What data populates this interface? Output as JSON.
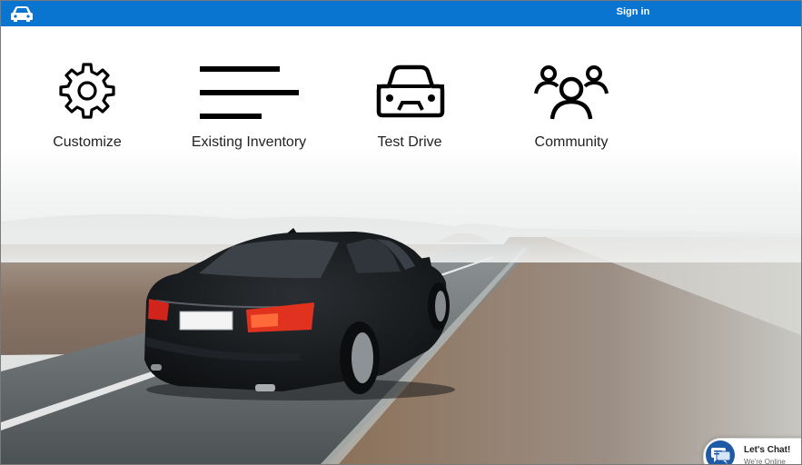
{
  "header": {
    "logo_icon": "car-icon",
    "signin_label": "Sign in",
    "bar_color": "#0a74d1"
  },
  "nav": {
    "items": [
      {
        "label": "Customize",
        "icon": "gear-icon"
      },
      {
        "label": "Existing Inventory",
        "icon": "list-icon"
      },
      {
        "label": "Test Drive",
        "icon": "car-icon"
      },
      {
        "label": "Community",
        "icon": "people-icon"
      }
    ]
  },
  "chat": {
    "title": "Let's Chat!",
    "status": "We're Online",
    "icon": "chat-icon"
  }
}
